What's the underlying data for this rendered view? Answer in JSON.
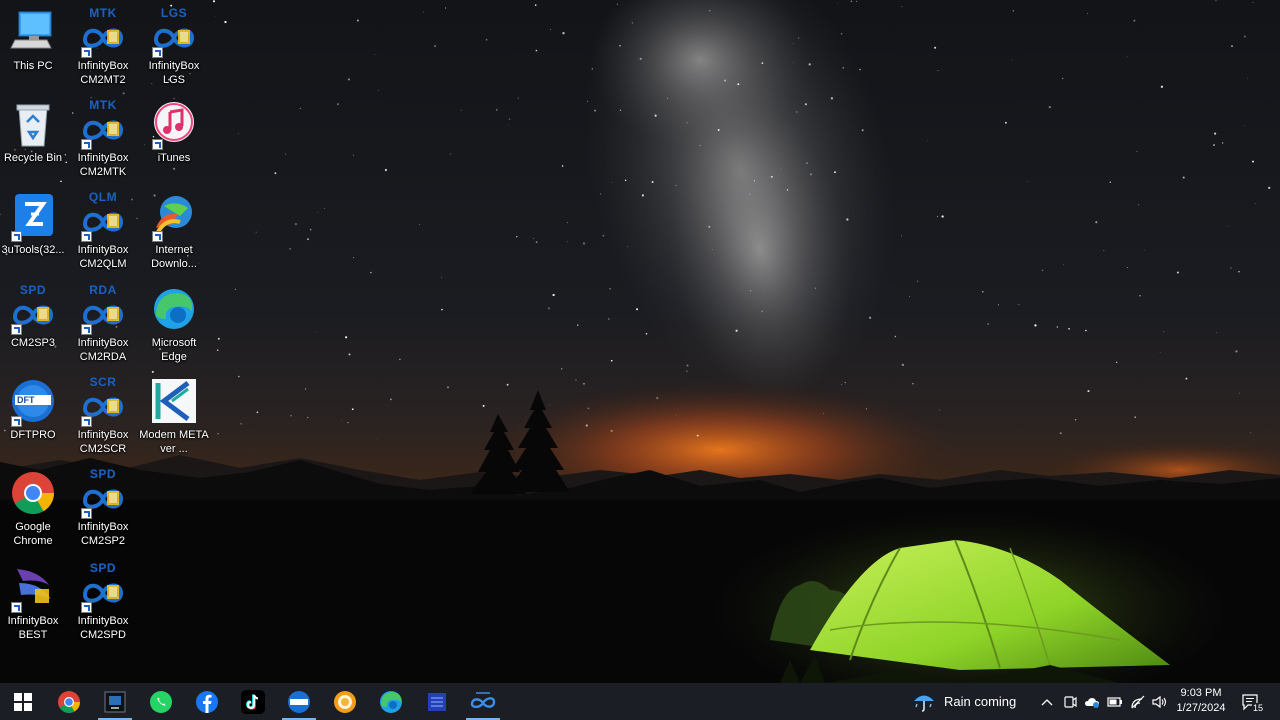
{
  "desktop": {
    "icons": [
      {
        "label": "This PC"
      },
      {
        "label": "Recycle Bin"
      },
      {
        "label": "3uTools(32..."
      },
      {
        "label": "CM2SP3",
        "badge": "SPD"
      },
      {
        "label": "DFTPRO"
      },
      {
        "label": "Google Chrome"
      },
      {
        "label": "InfinityBox BEST"
      },
      {
        "label": "InfinityBox CM2MT2",
        "badge": "MTK"
      },
      {
        "label": "InfinityBox CM2MTK",
        "badge": "MTK"
      },
      {
        "label": "InfinityBox CM2QLM",
        "badge": "QLM"
      },
      {
        "label": "InfinityBox CM2RDA",
        "badge": "RDA"
      },
      {
        "label": "InfinityBox CM2SCR",
        "badge": "SCR"
      },
      {
        "label": "InfinityBox CM2SP2",
        "badge": "SPD"
      },
      {
        "label": "InfinityBox CM2SPD",
        "badge": "SPD"
      },
      {
        "label": "InfinityBox LGS",
        "badge": "LGS"
      },
      {
        "label": "iTunes"
      },
      {
        "label": "Internet Downlo..."
      },
      {
        "label": "Microsoft Edge"
      },
      {
        "label": "Modem META ver ..."
      }
    ],
    "dftpro_badge": "DFT"
  },
  "taskbar": {
    "apps": [
      {
        "icon": "windows-start-icon"
      },
      {
        "icon": "chrome-icon"
      },
      {
        "icon": "monitor-app-icon"
      },
      {
        "icon": "whatsapp-icon"
      },
      {
        "icon": "facebook-icon"
      },
      {
        "icon": "tiktok-icon"
      },
      {
        "icon": "dftpro-icon"
      },
      {
        "icon": "orange-app-icon"
      },
      {
        "icon": "edge-icon"
      },
      {
        "icon": "blue-app-icon"
      },
      {
        "icon": "infinitybox-icon"
      }
    ],
    "weather": {
      "text": "Rain coming",
      "icon": "rain-umbrella-icon"
    },
    "clock": {
      "time": "9:03 PM",
      "date": "1/27/2024"
    },
    "notifications": {
      "count": "15"
    }
  },
  "colors": {
    "taskbar": "#1b1e24",
    "tent": "#9bdc2e",
    "horizon_glow": "#e0641c",
    "infinity_blue": "#1e6fd0",
    "infinity_yellow": "#f2c21a"
  }
}
